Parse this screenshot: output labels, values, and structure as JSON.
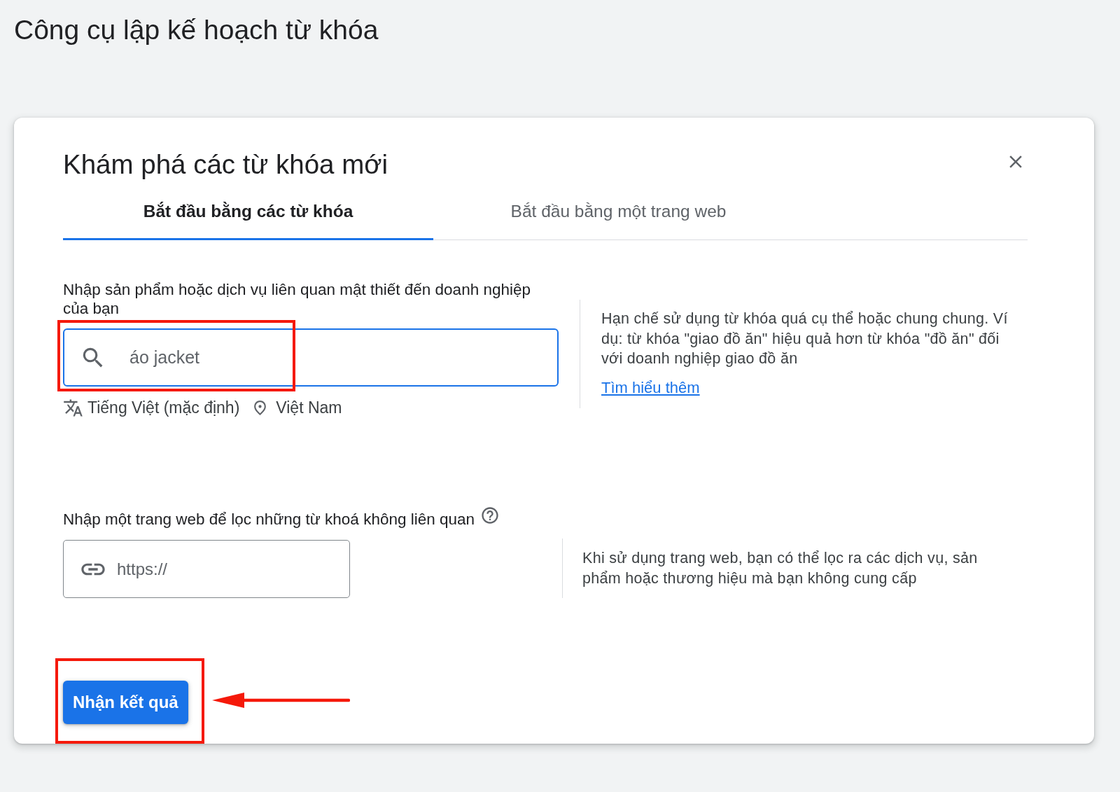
{
  "page_title": "Công cụ lập kế hoạch từ khóa",
  "dialog": {
    "title": "Khám phá các từ khóa mới",
    "tabs": [
      {
        "label": "Bắt đầu bằng các từ khóa",
        "selected": true
      },
      {
        "label": "Bắt đầu bằng một trang web",
        "selected": false
      }
    ],
    "keyword_section": {
      "label": "Nhập sản phẩm hoặc dịch vụ liên quan mật thiết đến doanh nghiệp của bạn",
      "search_field": {
        "value": "áo jacket",
        "focused": true,
        "highlighted": true
      },
      "language": "Tiếng Việt (mặc định)",
      "location": "Việt Nam",
      "hint": "Hạn chế sử dụng từ khóa quá cụ thể hoặc chung chung. Ví dụ: từ khóa \"giao đồ ăn\" hiệu quả hơn từ khóa \"đồ ăn\" đối với doanh nghiệp giao đồ ăn",
      "link": "Tìm hiểu thêm"
    },
    "website_section": {
      "label": "Nhập một trang web để lọc những từ khoá không liên quan",
      "url_field": {
        "placeholder": "https://"
      },
      "hint": "Khi sử dụng trang web, bạn có thể lọc ra các dịch vụ, sản phẩm hoặc thương hiệu mà bạn không cung cấp"
    },
    "submit_button": {
      "label": "Nhận kết quả",
      "highlighted": true,
      "arrow": true
    }
  }
}
